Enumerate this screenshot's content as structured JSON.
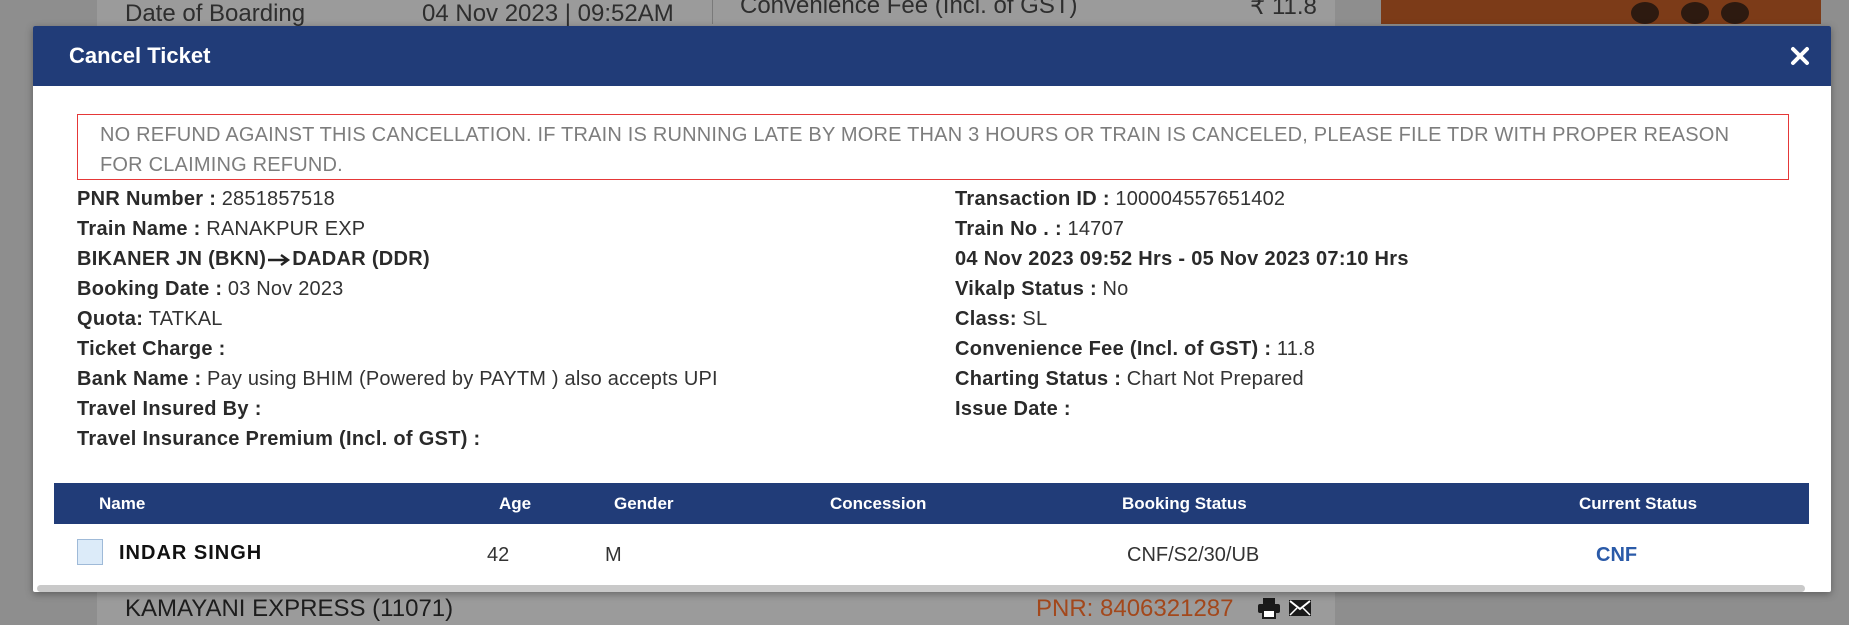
{
  "background": {
    "date_label": "Date of Boarding",
    "date_value": "04 Nov 2023 | 09:52AM",
    "convenience_label": "Convenience Fee (Incl. of GST)",
    "convenience_value": "₹ 11.8",
    "next_train": "KAMAYANI EXPRESS (11071)",
    "next_pnr": "PNR: 8406321287"
  },
  "modal": {
    "title": "Cancel Ticket",
    "close_symbol": "×",
    "notice": "NO REFUND AGAINST THIS CANCELLATION. IF TRAIN IS RUNNING LATE BY MORE THAN 3 HOURS OR TRAIN IS CANCELED, PLEASE FILE TDR WITH PROPER REASON FOR CLAIMING REFUND."
  },
  "details_left": {
    "pnr_label": "PNR Number :",
    "pnr_value": "2851857518",
    "train_name_label": "Train Name :",
    "train_name_value": "RANAKPUR EXP",
    "route_from": "BIKANER JN (BKN)",
    "route_to": "DADAR (DDR)",
    "booking_date_label": "Booking Date :",
    "booking_date_value": "03 Nov 2023",
    "quota_label": "Quota:",
    "quota_value": "TATKAL",
    "ticket_charge_label": "Ticket Charge :",
    "ticket_charge_value": "",
    "bank_label": "Bank Name :",
    "bank_value": "Pay using BHIM (Powered by PAYTM ) also accepts UPI",
    "insured_label": "Travel Insured By :",
    "insured_value": "",
    "premium_label": "Travel Insurance Premium (Incl. of GST) :",
    "premium_value": ""
  },
  "details_right": {
    "txn_label": "Transaction ID :",
    "txn_value": "100004557651402",
    "train_no_label": "Train No . :",
    "train_no_value": "14707",
    "journey": "04 Nov 2023 09:52 Hrs - 05 Nov 2023 07:10 Hrs",
    "vikalp_label": "Vikalp Status :",
    "vikalp_value": "No",
    "class_label": "Class:",
    "class_value": "SL",
    "conv_fee_label": "Convenience Fee (Incl. of GST) :",
    "conv_fee_value": "11.8",
    "charting_label": "Charting Status :",
    "charting_value": "Chart Not Prepared",
    "issue_date_label": "Issue Date :",
    "issue_date_value": ""
  },
  "passenger_table": {
    "headers": [
      "Name",
      "Age",
      "Gender",
      "Concession",
      "Booking Status",
      "Current Status"
    ],
    "rows": [
      {
        "name": "INDAR SINGH",
        "age": "42",
        "gender": "M",
        "concession": "",
        "booking_status": "CNF/S2/30/UB",
        "current_status": "CNF"
      }
    ]
  },
  "colors": {
    "header_blue": "#213c78",
    "notice_border": "#e53838",
    "status_blue": "#2a5aa8",
    "pnr_orange": "#a3481c"
  }
}
